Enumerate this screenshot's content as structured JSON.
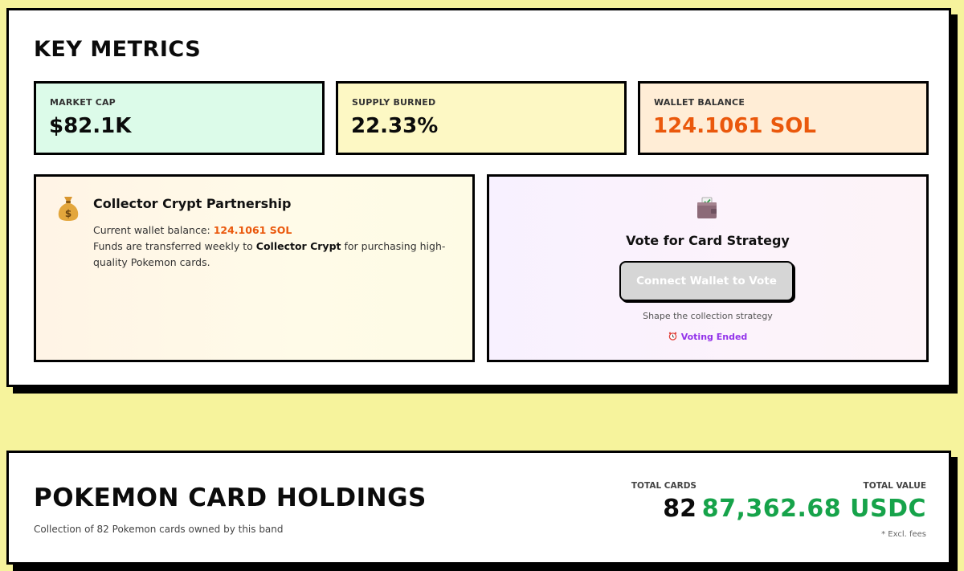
{
  "key_metrics": {
    "title": "KEY METRICS",
    "market_cap": {
      "label": "MARKET CAP",
      "value": "$82.1K"
    },
    "supply_burned": {
      "label": "SUPPLY BURNED",
      "value": "22.33%"
    },
    "wallet_balance": {
      "label": "WALLET BALANCE",
      "value": "124.1061 SOL"
    }
  },
  "partnership": {
    "icon": "money-bag-icon",
    "title": "Collector Crypt Partnership",
    "balance_prefix": "Current wallet balance: ",
    "balance_value": "124.1061 SOL",
    "transfer_prefix": "Funds are transferred weekly to ",
    "partner_name": "Collector Crypt",
    "transfer_suffix": " for purchasing high-quality Pokemon cards."
  },
  "vote": {
    "icon": "wallet-icon",
    "title": "Vote for Card Strategy",
    "button_label": "Connect Wallet to Vote",
    "subtitle": "Shape the collection strategy",
    "status_icon": "alarm-clock-icon",
    "status": "Voting Ended"
  },
  "holdings": {
    "title": "POKEMON CARD HOLDINGS",
    "subtitle": "Collection of 82 Pokemon cards owned by this band",
    "total_cards_label": "TOTAL CARDS",
    "total_cards_value": "82",
    "total_value_label": "TOTAL VALUE",
    "total_value_value": "87,362.68 USDC",
    "fee_note": "* Excl. fees"
  },
  "colors": {
    "page_background": "#f6f39c",
    "market_cap_bg": "#dcfbe9",
    "supply_burned_bg": "#fdf8c4",
    "wallet_balance_bg": "#ffedd6",
    "accent_orange": "#ea580c",
    "accent_green": "#16a34a",
    "accent_purple": "#9333ea"
  }
}
